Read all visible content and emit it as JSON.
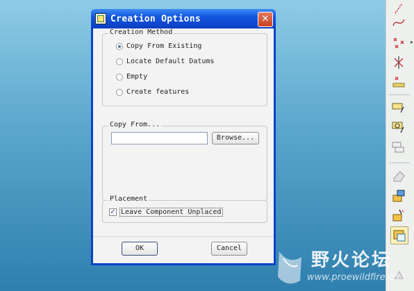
{
  "dialog": {
    "title": "Creation Options",
    "close_glyph": "✕",
    "creation_method": {
      "legend": "Creation Method",
      "options": [
        {
          "label": "Copy From Existing",
          "checked": true
        },
        {
          "label": "Locate Default Datums",
          "checked": false
        },
        {
          "label": "Empty",
          "checked": false
        },
        {
          "label": "Create features",
          "checked": false
        }
      ]
    },
    "copy_from": {
      "legend": "Copy From...",
      "value": "",
      "browse_label": "Browse..."
    },
    "placement": {
      "legend": "Placement",
      "checkbox_label": "Leave Component Unplaced",
      "checked": true,
      "check_glyph": "✓"
    },
    "ok_label": "OK",
    "cancel_label": "Cancel"
  },
  "toolbar": {
    "icons": [
      "sketch-line-icon",
      "spline-icon",
      "points-icon",
      "datum-point-cross-icon",
      "offset-points-icon",
      "axis-select-icon",
      "plane-tools-icon",
      "plane-alt-icon",
      "eraser-icon",
      "component-place-icon",
      "component-create-icon",
      "component-active-icon",
      "hidden-tool-icon"
    ],
    "more_glyph": "▸"
  },
  "watermark": {
    "title": "野火论坛",
    "url": "www.proewildfire.cn"
  }
}
